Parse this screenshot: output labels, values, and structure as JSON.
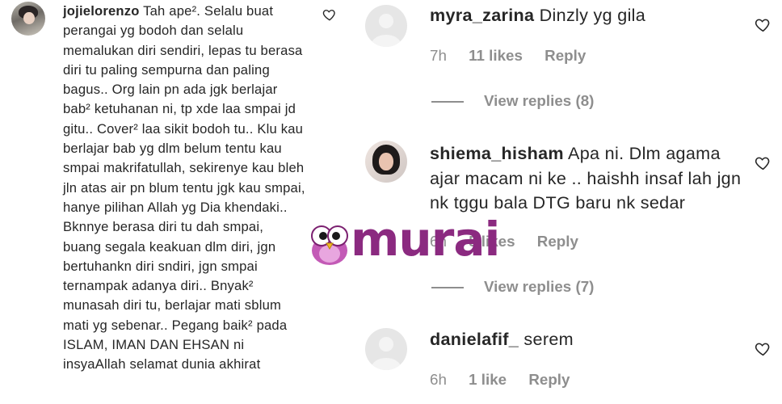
{
  "left_comment": {
    "username": "jojielorenzo",
    "text": "Tah ape². Selalu buat perangai yg bodoh dan selalu memalukan diri sendiri, lepas tu berasa diri tu paling sempurna dan paling bagus.. Org lain pn ada jgk berlajar bab² ketuhanan ni, tp xde laa smpai jd gitu.. Cover² laa sikit bodoh tu.. Klu kau berlajar bab yg dlm belum tentu kau smpai makrifatullah, sekirenye kau bleh jln atas air pn blum tentu jgk kau smpai, hanye pilihan Allah yg Dia khendaki.. Bknnye berasa diri tu dah smpai, buang segala keakuan dlm diri, jgn bertuhankn diri sndiri, jgn smpai ternampak adanya diri.. Bnyak² munasah diri tu, berlajar mati sblum mati yg sebenar.. Pegang baik² pada ISLAM, IMAN DAN EHSAN ni insyaAllah selamat dunia akhirat"
  },
  "right_comments": [
    {
      "username": "myra_zarina",
      "text": "Dinzly yg gila",
      "time": "7h",
      "likes": "11 likes",
      "reply": "Reply",
      "view_replies": "View replies (8)"
    },
    {
      "username": "shiema_hisham",
      "text": "Apa ni. Dlm agama ajar macam ni ke .. haishh insaf lah jgn nk tggu bala DTG baru nk sedar",
      "time": "6h",
      "likes": "5 likes",
      "reply": "Reply",
      "view_replies": "View replies (7)"
    },
    {
      "username": "danielafif_",
      "text": "serem",
      "time": "6h",
      "likes": "1 like",
      "reply": "Reply"
    }
  ],
  "watermark": {
    "brand": "murai"
  },
  "icons": {
    "like": "heart-outline-icon"
  },
  "colors": {
    "text": "#262626",
    "muted": "#8e8e8e",
    "brand": "#8b2a80"
  }
}
